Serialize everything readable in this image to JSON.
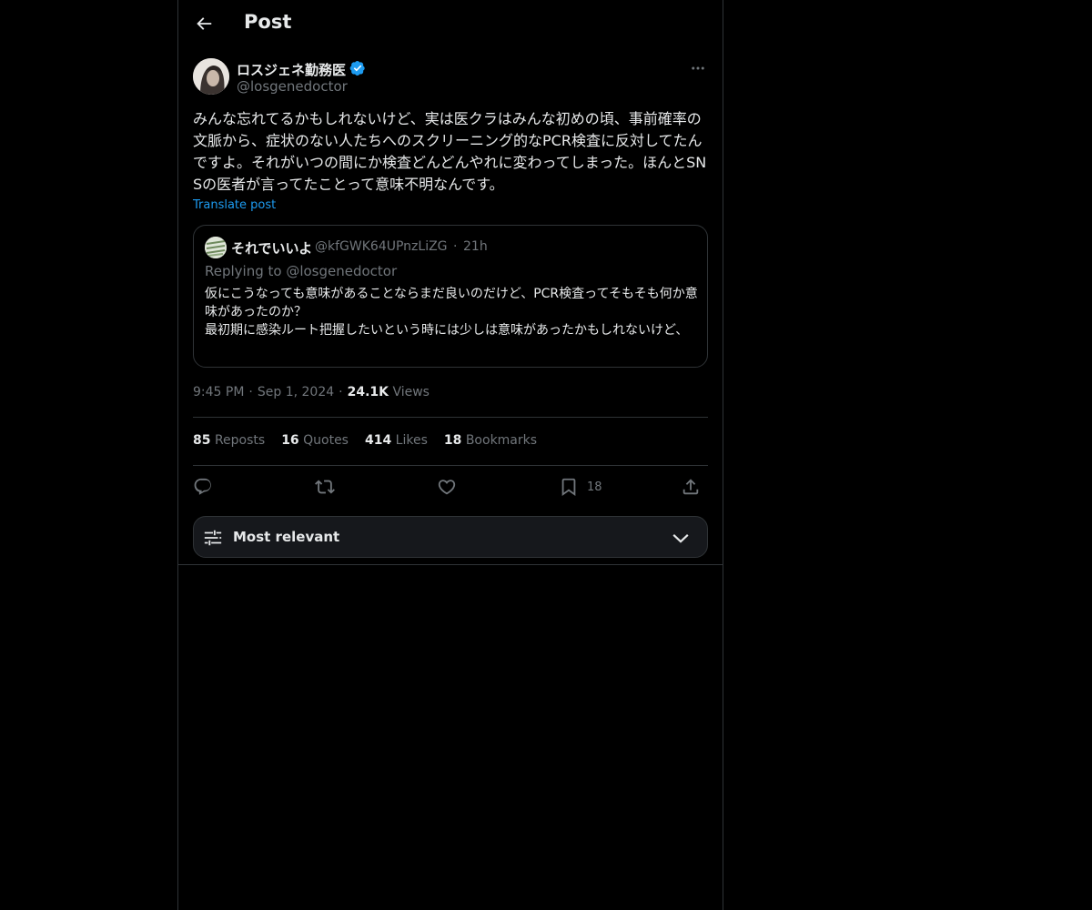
{
  "header": {
    "title": "Post"
  },
  "post": {
    "author": {
      "display_name": "ロスジェネ勤務医",
      "handle": "@losgenedoctor",
      "verified": true
    },
    "text": "みんな忘れてるかもしれないけど、実は医クラはみんな初めの頃、事前確率の文脈から、症状のない人たちへのスクリーニング的なPCR検査に反対してたんですよ。それがいつの間にか検査どんどんやれに変わってしまった。ほんとSNSの医者が言ってたことって意味不明なんです。",
    "translate_label": "Translate post",
    "time": "9:45 PM",
    "date": "Sep 1, 2024",
    "views_count": "24.1K",
    "views_label": "Views"
  },
  "quote": {
    "display_name": "それでいいよ",
    "handle": "@kfGWK64UPnzLiZG",
    "time": "21h",
    "replying_to": "Replying to @losgenedoctor",
    "text": "仮にこうなっても意味があることならまだ良いのだけど、PCR検査ってそもそも何か意味があったのか？\n最初期に感染ルート把握したいという時には少しは意味があったかもしれないけど、"
  },
  "stats": {
    "reposts_count": "85",
    "reposts_label": "Reposts",
    "quotes_count": "16",
    "quotes_label": "Quotes",
    "likes_count": "414",
    "likes_label": "Likes",
    "bookmarks_count": "18",
    "bookmarks_label": "Bookmarks"
  },
  "actions": {
    "bookmark_count": "18"
  },
  "sort": {
    "label": "Most relevant"
  },
  "colors": {
    "background": "#000000",
    "text": "#e7e9ea",
    "muted": "#71767b",
    "accent": "#1d9bf0",
    "border": "#2f3336"
  },
  "icons": [
    "back-arrow-icon",
    "verified-badge-icon",
    "more-icon",
    "reply-icon",
    "repost-icon",
    "like-icon",
    "bookmark-icon",
    "share-icon",
    "filter-sliders-icon",
    "chevron-down-icon"
  ]
}
